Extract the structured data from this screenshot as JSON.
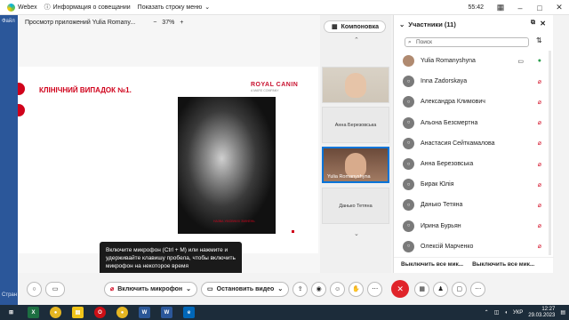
{
  "title_bar": {
    "app_name": "Webex",
    "meeting_info": "Информация о совещании",
    "show_menu": "Показать строку меню",
    "time": "55:42"
  },
  "word_strip": {
    "file_label": "Файл",
    "status_label": "Стран"
  },
  "share": {
    "viewer_title": "Просмотр приложений Yulia Romany...",
    "zoom_minus": "−",
    "zoom_value": "37%",
    "zoom_plus": "+"
  },
  "slide": {
    "title": "КЛІНІЧНИЙ ВИПАДОК №1.",
    "brand": "ROYAL CANIN",
    "brand_sub": "A MARS COMPANY",
    "xray_caption": "НАЗВА УМОВНИХ ЗМІНЕНЬ"
  },
  "tooltip": {
    "text": "Включите микрофон (Ctrl + M) или нажмите и удерживайте клавишу пробела, чтобы включить микрофон на некоторое время"
  },
  "thumbnails": {
    "layout_label": "Компоновка",
    "tiles": [
      {
        "label": ""
      },
      {
        "label": "Анна Березовська"
      },
      {
        "label": "Yulia Romanyshyna"
      },
      {
        "label": "Данько Тетяна"
      }
    ]
  },
  "participants": {
    "header": "Участники (11)",
    "search_placeholder": "Поиск",
    "list": [
      {
        "name": "Yulia Romanyshyna",
        "photo": true
      },
      {
        "name": "Inna Zadorskaya",
        "photo": false
      },
      {
        "name": "Александра Климович",
        "photo": false
      },
      {
        "name": "Альона Безсмертна",
        "photo": false
      },
      {
        "name": "Анастасия Сейткамалова",
        "photo": false
      },
      {
        "name": "Анна Березовська",
        "photo": false
      },
      {
        "name": "Бирак Юлія",
        "photo": false
      },
      {
        "name": "Данько Тетяна",
        "photo": false
      },
      {
        "name": "Ирина Бурьян",
        "photo": false
      },
      {
        "name": "Олексій Марченко",
        "photo": false
      }
    ],
    "mute_all": "Выключить все мик...",
    "mute_all_2": "Выключить все мик..."
  },
  "toolbar": {
    "mic_label": "Включить микрофон",
    "video_label": "Остановить видео"
  },
  "taskbar": {
    "lang": "УКР",
    "time": "12:27",
    "date": "29.03.2023"
  }
}
